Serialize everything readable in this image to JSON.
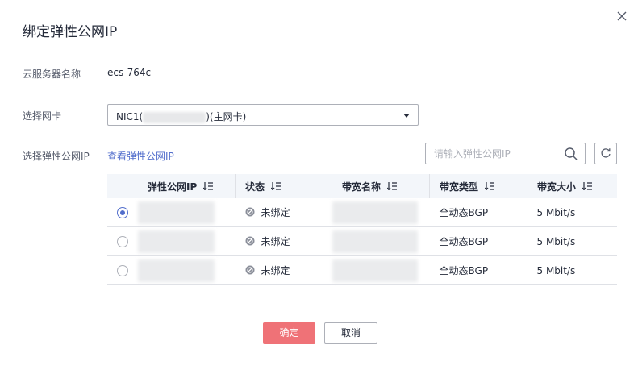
{
  "dialog": {
    "title": "绑定弹性公网IP",
    "server_label": "云服务器名称",
    "server_value": "ecs-764c",
    "nic_label": "选择网卡",
    "nic_prefix": "NIC1(",
    "nic_suffix": ")(主网卡)",
    "eip_label": "选择弹性公网IP",
    "view_eip_link": "查看弹性公网IP",
    "search_placeholder": "请输入弹性公网IP"
  },
  "table": {
    "columns": [
      "弹性公网IP",
      "状态",
      "带宽名称",
      "带宽类型",
      "带宽大小"
    ],
    "rows": [
      {
        "selected": true,
        "status": "未绑定",
        "bandwidth_type": "全动态BGP",
        "bandwidth_size": "5 Mbit/s"
      },
      {
        "selected": false,
        "status": "未绑定",
        "bandwidth_type": "全动态BGP",
        "bandwidth_size": "5 Mbit/s"
      },
      {
        "selected": false,
        "status": "未绑定",
        "bandwidth_type": "全动态BGP",
        "bandwidth_size": "5 Mbit/s"
      }
    ]
  },
  "buttons": {
    "ok": "确定",
    "cancel": "取消"
  },
  "colors": {
    "primary": "#526ecc",
    "confirm": "#ef7277"
  }
}
